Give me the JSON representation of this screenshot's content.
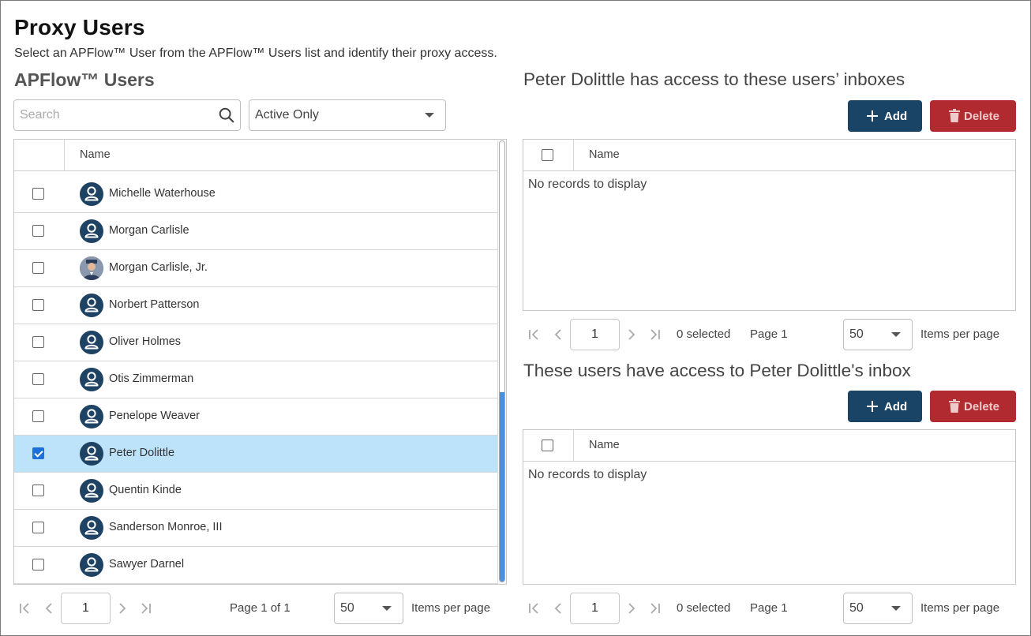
{
  "page": {
    "title": "Proxy Users",
    "subtitle": "Select an APFlow™ User from the APFlow™ Users list and identify their proxy access."
  },
  "users_panel": {
    "title": "APFlow™ Users",
    "search_placeholder": "Search",
    "filter_value": "Active Only",
    "column_name": "Name",
    "rows": [
      {
        "name": "Michelle Waterhouse",
        "checked": false,
        "selected": false,
        "avatar": "person-icon"
      },
      {
        "name": "Morgan Carlisle",
        "checked": false,
        "selected": false,
        "avatar": "person-icon"
      },
      {
        "name": "Morgan Carlisle, Jr.",
        "checked": false,
        "selected": false,
        "avatar": "photo-avatar"
      },
      {
        "name": "Norbert Patterson",
        "checked": false,
        "selected": false,
        "avatar": "person-icon"
      },
      {
        "name": "Oliver Holmes",
        "checked": false,
        "selected": false,
        "avatar": "person-icon"
      },
      {
        "name": "Otis Zimmerman",
        "checked": false,
        "selected": false,
        "avatar": "person-icon"
      },
      {
        "name": "Penelope Weaver",
        "checked": false,
        "selected": false,
        "avatar": "person-icon"
      },
      {
        "name": "Peter Dolittle",
        "checked": true,
        "selected": true,
        "avatar": "person-icon"
      },
      {
        "name": "Quentin Kinde",
        "checked": false,
        "selected": false,
        "avatar": "person-icon"
      },
      {
        "name": "Sanderson Monroe, III",
        "checked": false,
        "selected": false,
        "avatar": "person-icon"
      },
      {
        "name": "Sawyer Darnel",
        "checked": false,
        "selected": false,
        "avatar": "person-icon"
      }
    ],
    "pager": {
      "page": "1",
      "page_info": "Page 1 of 1",
      "page_size": "50",
      "items_per_page": "Items per page"
    }
  },
  "access_to": {
    "title": "Peter Dolittle has access to these users’ inboxes",
    "add_label": "Add",
    "delete_label": "Delete",
    "column_name": "Name",
    "empty": "No records to display",
    "pager": {
      "page": "1",
      "selected": "0 selected",
      "page_info": "Page 1",
      "page_size": "50",
      "items_per_page": "Items per page"
    }
  },
  "access_from": {
    "title": "These users have access to Peter Dolittle's inbox",
    "add_label": "Add",
    "delete_label": "Delete",
    "column_name": "Name",
    "empty": "No records to display",
    "pager": {
      "page": "1",
      "selected": "0 selected",
      "page_info": "Page 1",
      "page_size": "50",
      "items_per_page": "Items per page"
    }
  },
  "colors": {
    "primary": "#1a4466",
    "danger": "#b02a2f",
    "selected_row": "#bde3fb",
    "checkbox": "#1e6fd9"
  }
}
